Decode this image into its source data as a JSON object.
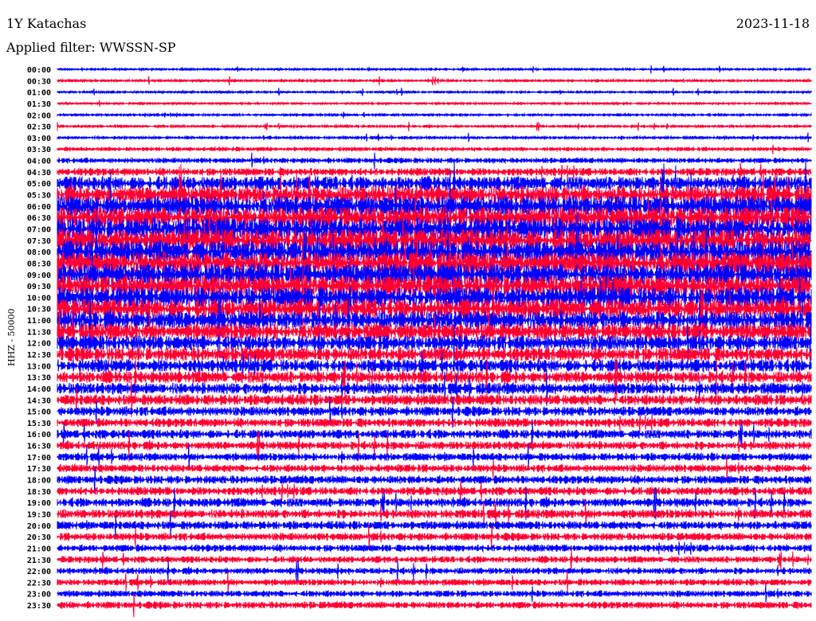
{
  "header": {
    "station": "1Y Katachas",
    "filter": "Applied filter: WWSSN-SP",
    "date": "2023-11-18"
  },
  "chart_data": {
    "type": "line",
    "title": "1Y Katachas",
    "subtitle": "Applied filter: WWSSN-SP",
    "ylabel": "HHZ - 50000",
    "xlabel": "",
    "colors": [
      "#0000ff",
      "#ff0033"
    ],
    "rows": [
      "00:00",
      "00:30",
      "01:00",
      "01:30",
      "02:00",
      "02:30",
      "03:00",
      "03:30",
      "04:00",
      "04:30",
      "05:00",
      "05:30",
      "06:00",
      "06:30",
      "07:00",
      "07:30",
      "08:00",
      "08:30",
      "09:00",
      "09:30",
      "10:00",
      "10:30",
      "11:00",
      "11:30",
      "12:00",
      "12:30",
      "13:00",
      "13:30",
      "14:00",
      "14:30",
      "15:00",
      "15:30",
      "16:00",
      "16:30",
      "17:00",
      "17:30",
      "18:00",
      "18:30",
      "19:00",
      "19:30",
      "20:00",
      "20:30",
      "21:00",
      "21:30",
      "22:00",
      "22:30",
      "23:00",
      "23:30"
    ],
    "relative_amplitude": [
      0.35,
      0.4,
      0.35,
      0.35,
      0.4,
      0.4,
      0.45,
      0.6,
      0.8,
      1.2,
      2.2,
      2.8,
      3.2,
      3.4,
      3.6,
      3.6,
      3.6,
      3.6,
      3.5,
      3.4,
      3.3,
      3.1,
      2.9,
      2.6,
      2.4,
      2.2,
      2.0,
      1.9,
      1.8,
      1.7,
      1.5,
      1.4,
      1.4,
      1.3,
      1.2,
      1.2,
      1.3,
      1.3,
      1.4,
      1.4,
      1.3,
      1.2,
      1.1,
      1.0,
      1.0,
      1.0,
      1.0,
      1.1
    ]
  }
}
